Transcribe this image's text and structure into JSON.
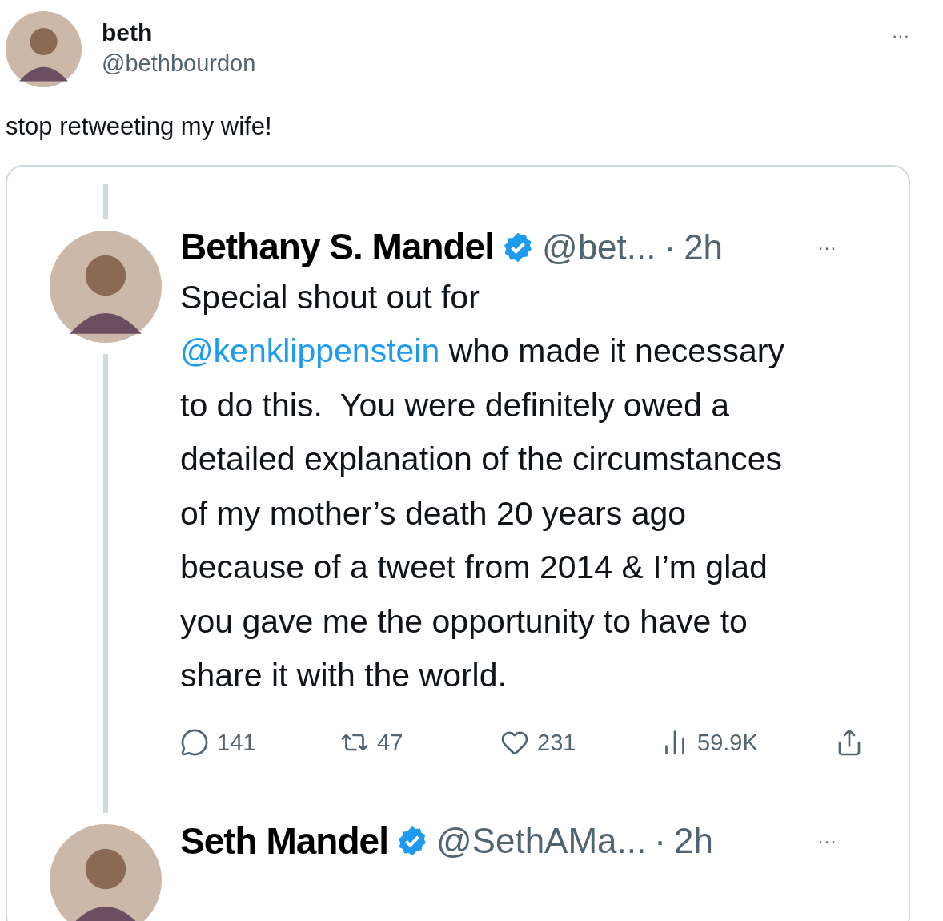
{
  "tweet": {
    "author": {
      "name": "beth",
      "handle": "@bethbourdon"
    },
    "more": "···",
    "text": "stop retweeting my wife!",
    "screenshot": {
      "tweets": [
        {
          "name": "Bethany S. Mandel",
          "verified": true,
          "handle": "@bet...",
          "separator": "·",
          "time": "2h",
          "more": "···",
          "body": [
            {
              "kind": "text",
              "text": "Special shout out for\n"
            },
            {
              "kind": "mention",
              "text": "@kenklippenstein"
            },
            {
              "kind": "text",
              "text": " who made it necessary to do this.  You were definitely owed a detailed explanation of the circumstances of my mother’s death 20 years ago because of a tweet from 2014 & I’m glad you gave me the opportunity to have to share it with the world."
            }
          ],
          "stats": [
            {
              "kind": "reply",
              "text": "141"
            },
            {
              "kind": "retweet",
              "text": "47"
            },
            {
              "kind": "like",
              "text": "231"
            },
            {
              "kind": "views",
              "text": "59.9K"
            },
            {
              "kind": "share"
            }
          ]
        },
        {
          "name": "Seth Mandel",
          "verified": true,
          "handle": "@SethAMa...",
          "separator": "·",
          "time": "2h",
          "more": "···"
        }
      ]
    }
  }
}
